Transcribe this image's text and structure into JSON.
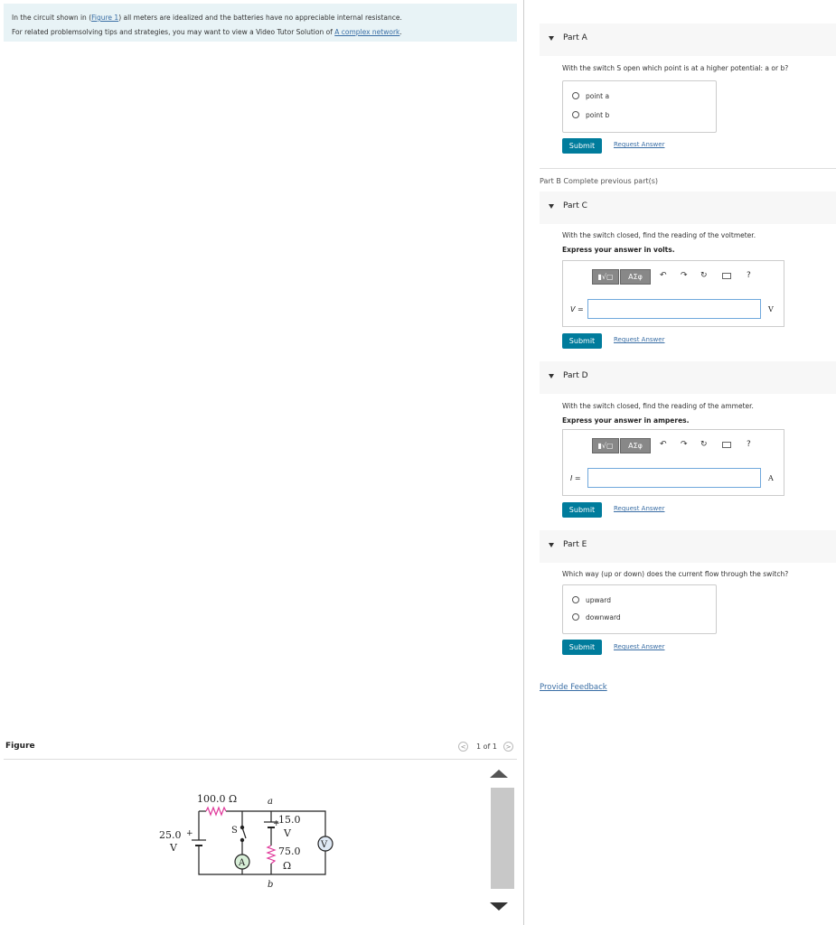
{
  "intro": {
    "line1_pre": "In the circuit shown in (",
    "line1_link": "Figure 1",
    "line1_post": ") all meters are idealized and the batteries have no appreciable internal resistance.",
    "line2_pre": "For related problemsolving tips and strategies, you may want to view a Video Tutor Solution of ",
    "line2_link": "A complex network",
    "line2_post": "."
  },
  "figure": {
    "label": "Figure",
    "pager": "1 of 1",
    "prev": "<",
    "next": ">",
    "circuit": {
      "r1": "100.0 Ω",
      "battery1_a": "25.0",
      "battery1_b": "V",
      "battery1_plus": "+",
      "switch": "S",
      "node_a": "a",
      "node_b": "b",
      "battery2_a": "15.0",
      "battery2_b": "V",
      "battery2_plus": "+",
      "r2_a": "75.0",
      "r2_b": "Ω",
      "ammeter": "A",
      "voltmeter": "V"
    }
  },
  "partA": {
    "label": "Part A",
    "question": "With the switch S open which point is at a higher potential: a or b?",
    "options": [
      "point a",
      "point b"
    ],
    "submit": "Submit",
    "request": "Request Answer"
  },
  "partB": {
    "text": "Part B  Complete previous part(s)"
  },
  "partC": {
    "label": "Part C",
    "question": "With the switch closed, find the reading of the voltmeter.",
    "instruction": "Express your answer in volts.",
    "var": "V =",
    "unit": "V",
    "submit": "Submit",
    "request": "Request Answer"
  },
  "partD": {
    "label": "Part D",
    "question": "With the switch closed, find the reading of the ammeter.",
    "instruction": "Express your answer in amperes.",
    "var": "I =",
    "unit": "A",
    "submit": "Submit",
    "request": "Request Answer"
  },
  "partE": {
    "label": "Part E",
    "question": "Which way (up or down) does the current flow through the switch?",
    "options": [
      "upward",
      "downward"
    ],
    "submit": "Submit",
    "request": "Request Answer"
  },
  "toolbar": {
    "templates": "▮√▢",
    "greek": "ΑΣφ",
    "help": "?"
  },
  "feedback": "Provide Feedback"
}
